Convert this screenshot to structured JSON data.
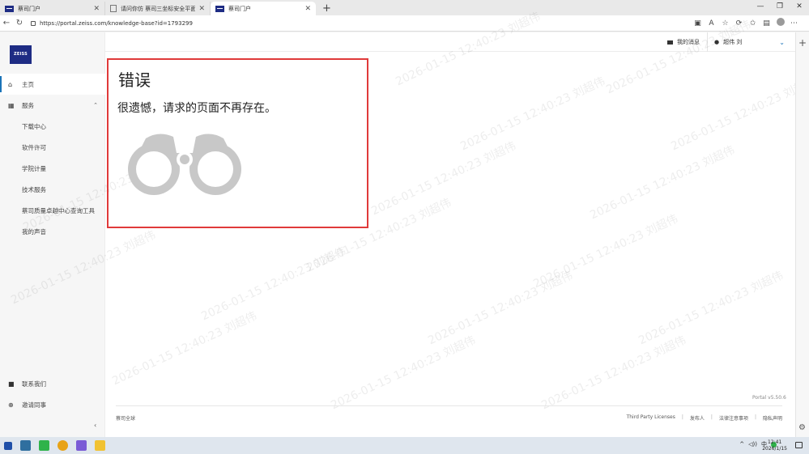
{
  "browser": {
    "tabs": [
      {
        "label": "蔡司门户",
        "active": false
      },
      {
        "label": "请问你仿 蔡司三坐标安全平面…",
        "active": false
      },
      {
        "label": "蔡司门户",
        "active": true
      }
    ],
    "new_tab": "+",
    "url": "https://portal.zeiss.com/knowledge-base?id=1793299",
    "window_controls": [
      "—",
      "❐",
      "✕"
    ]
  },
  "sidebar": {
    "logo": "ZEISS",
    "items": [
      {
        "label": "主页",
        "icon": "home-icon",
        "glyph": "⌂",
        "selected": true
      },
      {
        "label": "服务",
        "icon": "grid-icon",
        "glyph": "▦",
        "chevron": "⌃"
      }
    ],
    "sub_items": [
      "下载中心",
      "软件许可",
      "学院计量",
      "技术服务",
      "蔡司质量卓越中心查询工具",
      "我的声音"
    ],
    "bottom_items": [
      {
        "label": "联系我们",
        "icon": "chat-icon",
        "glyph": "■"
      },
      {
        "label": "邀请同事",
        "icon": "add-user-icon",
        "glyph": "⊕"
      }
    ],
    "collapse": "‹"
  },
  "header": {
    "messages": "我的消息",
    "user_name": "超伟 刘",
    "caret": "⌄"
  },
  "error": {
    "title": "错误",
    "message": "很遗憾，请求的页面不再存在。"
  },
  "footer": {
    "version": "Portal v5.50.6",
    "copyright": "蔡司全球",
    "links": [
      "Third Party Licenses",
      "发布人",
      "法律注意事项",
      "隐私声明"
    ]
  },
  "watermark": "2026-01-15 12:40:23 刘超伟",
  "taskbar": {
    "tray": [
      "^",
      "◁))",
      "中"
    ],
    "time": "12:41",
    "date": "2026/1/15"
  },
  "colors": {
    "accent": "#1a73b8",
    "brand": "#1e2c84",
    "error_border": "#e03a3a"
  }
}
